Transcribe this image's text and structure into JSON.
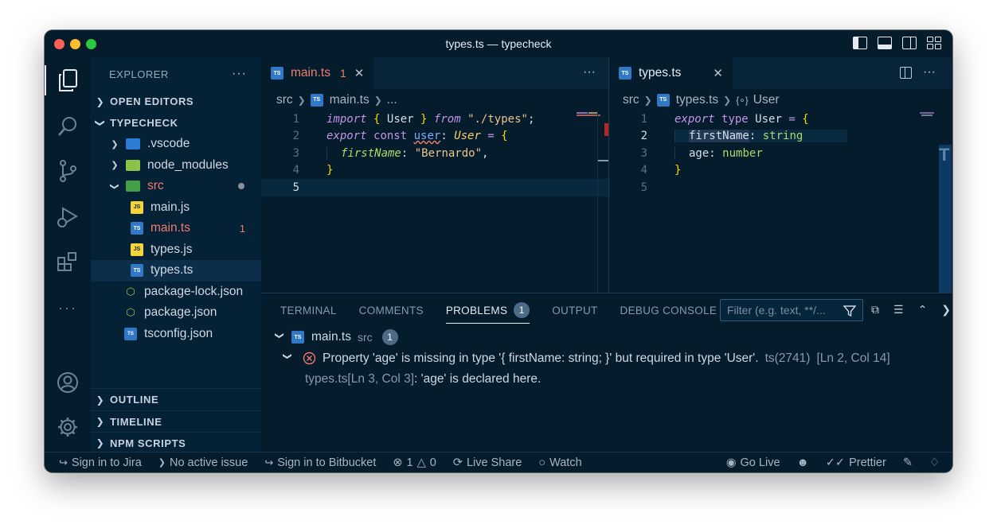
{
  "window": {
    "title": "types.ts — typecheck"
  },
  "sidebar": {
    "header": "EXPLORER",
    "open_editors": "OPEN EDITORS",
    "project": "TYPECHECK",
    "tree": [
      {
        "label": ".vscode",
        "kind": "folder",
        "icon": "vscode-folder-icon"
      },
      {
        "label": "node_modules",
        "kind": "folder",
        "icon": "node-folder-icon"
      },
      {
        "label": "src",
        "kind": "folder-open",
        "icon": "src-folder-icon"
      },
      {
        "label": "main.js",
        "kind": "js"
      },
      {
        "label": "main.ts",
        "kind": "ts",
        "errors": "1"
      },
      {
        "label": "types.js",
        "kind": "js"
      },
      {
        "label": "types.ts",
        "kind": "ts"
      },
      {
        "label": "package-lock.json",
        "kind": "json"
      },
      {
        "label": "package.json",
        "kind": "json"
      },
      {
        "label": "tsconfig.json",
        "kind": "tsconfig"
      }
    ],
    "outline": "OUTLINE",
    "timeline": "TIMELINE",
    "npm_scripts": "NPM SCRIPTS"
  },
  "editor_left": {
    "tab_label": "main.ts",
    "tab_errors": "1",
    "icon_text": "TS",
    "crumbs": {
      "folder": "src",
      "file": "main.ts",
      "rest": "..."
    },
    "line_numbers": [
      "1",
      "2",
      "3",
      "4",
      "5"
    ],
    "code": {
      "l1": {
        "kw": "import",
        "ob": "{",
        "name": "User",
        "cb": "}",
        "from": "from",
        "path": "\"./types\"",
        "semi": ";"
      },
      "l2": {
        "export": "export",
        "const": "const",
        "var": "user",
        "colon": ":",
        "type": "User",
        "eq": "=",
        "ob": "{"
      },
      "l3": {
        "prop": "firstName",
        "colon": ":",
        "value": "\"Bernardo\"",
        "comma": ","
      },
      "l4": {
        "cb": "}"
      }
    }
  },
  "editor_right": {
    "tab_label": "types.ts",
    "icon_text": "TS",
    "crumbs": {
      "folder": "src",
      "file": "types.ts",
      "symbol": "User"
    },
    "line_numbers": [
      "1",
      "2",
      "3",
      "4",
      "5"
    ],
    "code": {
      "l1": {
        "export": "export",
        "type": "type",
        "name": "User",
        "eq": "=",
        "ob": "{"
      },
      "l2": {
        "prop": "firstName",
        "colon": ":",
        "ptype": "string"
      },
      "l3": {
        "prop": "age",
        "colon": ":",
        "ptype": "number"
      },
      "l4": {
        "cb": "}"
      }
    }
  },
  "panel": {
    "tabs": [
      "TERMINAL",
      "COMMENTS",
      "PROBLEMS",
      "OUTPUT",
      "DEBUG CONSOLE"
    ],
    "problems_badge": "1",
    "filter_placeholder": "Filter (e.g. text, **/...",
    "file_row": {
      "file": "main.ts",
      "folder": "src",
      "count": "1"
    },
    "problem": {
      "message": "Property 'age' is missing in type '{ firstName: string; }' but required in type 'User'.",
      "code": "ts(2741)",
      "location": "[Ln 2, Col 14]"
    },
    "related": {
      "file": "types.ts",
      "location": "[Ln 3, Col 3]",
      "message": ": 'age' is declared here."
    }
  },
  "statusbar": {
    "jira": "Sign in to Jira",
    "issue": "No active issue",
    "bitbucket": "Sign in to Bitbucket",
    "errors": "1",
    "warnings": "0",
    "live_share": "Live Share",
    "watch": "Watch",
    "go_live": "Go Live",
    "prettier": "Prettier"
  },
  "colors": {
    "background": "#041c2c",
    "sidebar": "#052136",
    "error": "#f07c6a",
    "ts_icon": "#3178c6",
    "js_icon": "#f0d43a"
  }
}
